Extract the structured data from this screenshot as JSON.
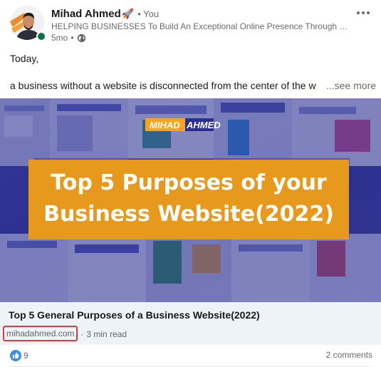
{
  "author": {
    "name": "Mihad Ahmed",
    "name_emoji": "🚀",
    "degree": "• You",
    "headline": "HELPING BUSINESSES To Build An Exceptional Online Presence Through WEB...",
    "time": "5mo",
    "time_separator": "•",
    "visibility_icon": "globe-icon",
    "presence_color": "#057642"
  },
  "post": {
    "line1": "Today,",
    "line2": "a business without a website is disconnected from the center of the world",
    "see_more": "...see more"
  },
  "media": {
    "brand_highlight": "MIHAD",
    "brand_rest": "AHMED",
    "headline_line1": "Top 5 Purposes of your",
    "headline_line2": "Business Website(2022)",
    "banner_color": "#e6991c",
    "brand_color": "#f7a51e"
  },
  "article": {
    "title": "Top 5 General Purposes of a Business Website(2022)",
    "source": "mihadahmed.com",
    "separator": "·",
    "read_time": "3 min read",
    "highlight_color": "#e23a3a"
  },
  "social": {
    "reactions": "9",
    "reaction_icon": "like-icon",
    "comments": "2 comments"
  }
}
